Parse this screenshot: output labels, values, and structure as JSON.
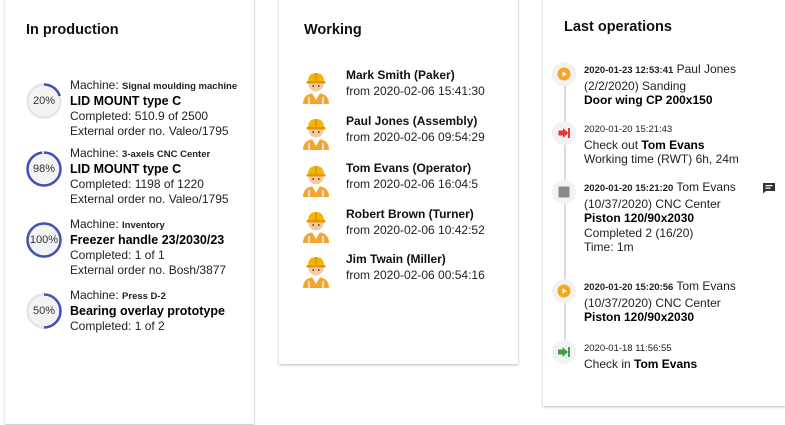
{
  "production": {
    "title": "In production",
    "items": [
      {
        "percent_label": "20%",
        "progress": 0.2,
        "machine_prefix": "Machine: ",
        "machine": "Signal moulding machine",
        "product": "LID MOUNT type C",
        "completed": "Completed: 510.9 of 2500",
        "order": "External order no. Valeo/1795"
      },
      {
        "percent_label": "98%",
        "progress": 0.98,
        "machine_prefix": "Machine: ",
        "machine": "3-axels CNC Center",
        "product": "LID MOUNT type C",
        "completed": "Completed: 1198 of 1220",
        "order": "External order no. Valeo/1795"
      },
      {
        "percent_label": "100%",
        "progress": 1.0,
        "machine_prefix": "Machine: ",
        "machine": "Inventory",
        "product": "Freezer handle 23/2030/23",
        "completed": "Completed: 1 of 1",
        "order": "External order no. Bosh/3877"
      },
      {
        "percent_label": "50%",
        "progress": 0.5,
        "machine_prefix": "Machine: ",
        "machine": "Press D-2",
        "product": "Bearing overlay prototype",
        "completed": "Completed: 1 of 2",
        "order": ""
      }
    ]
  },
  "working": {
    "title": "Working",
    "workers": [
      {
        "name": "Mark Smith (Paker)",
        "from": "from 2020-02-06 15:41:30",
        "icon": "worker-avatar-icon"
      },
      {
        "name": "Paul Jones (Assembly)",
        "from": "from 2020-02-06 09:54:29",
        "icon": "worker-avatar-icon"
      },
      {
        "name": "Tom Evans (Operator)",
        "from": "from 2020-02-06 16:04:5",
        "icon": "worker-avatar-icon"
      },
      {
        "name": "Robert Brown (Turner)",
        "from": "from 2020-02-06 10:42:52",
        "icon": "worker-avatar-icon"
      },
      {
        "name": "Jim Twain (Miller)",
        "from": "from 2020-02-06 00:54:16",
        "icon": "worker-avatar-icon"
      }
    ]
  },
  "operations": {
    "title": "Last operations",
    "items": [
      {
        "icon": "play-icon",
        "color": "#f5a623",
        "timestamp": "2020-01-23 12:53:41",
        "actor": " Paul Jones",
        "line2": "(2/2/2020) Sanding",
        "line3": "Door wing CP 200x150",
        "line4": ""
      },
      {
        "icon": "check-out-icon",
        "color": "#e53935",
        "timestamp": "2020-01-20 15:21:43",
        "actor": "",
        "line2_prefix": "Check out ",
        "line2_strong": "Tom Evans",
        "line3": "Working time (RWT) 6h, 24m",
        "line4": ""
      },
      {
        "icon": "stop-icon",
        "color": "#8a8a8a",
        "timestamp": "2020-01-20 15:21:20",
        "actor": " Tom Evans",
        "line2": "(10/37/2020) CNC Center",
        "line3": "Piston 120/90x2030",
        "line4": "Completed 2 (16/20)",
        "line5": "Time: 1m"
      },
      {
        "icon": "play-icon",
        "color": "#f5a623",
        "timestamp": "2020-01-20 15:20:56",
        "actor": " Tom Evans",
        "line2": "(10/37/2020) CNC Center",
        "line3": "Piston 120/90x2030",
        "line4": ""
      },
      {
        "icon": "check-in-icon",
        "color": "#43a047",
        "timestamp": "2020-01-18 11:56:55",
        "actor": "",
        "line2_prefix": "Check in ",
        "line2_strong": "Tom Evans",
        "line3": "",
        "line4": ""
      }
    ],
    "comment_icon": "comment-icon"
  },
  "colors": {
    "ring": "#3f51b5",
    "ring_track": "#e6e6e6",
    "ring_fill": "#f3f3f3"
  }
}
